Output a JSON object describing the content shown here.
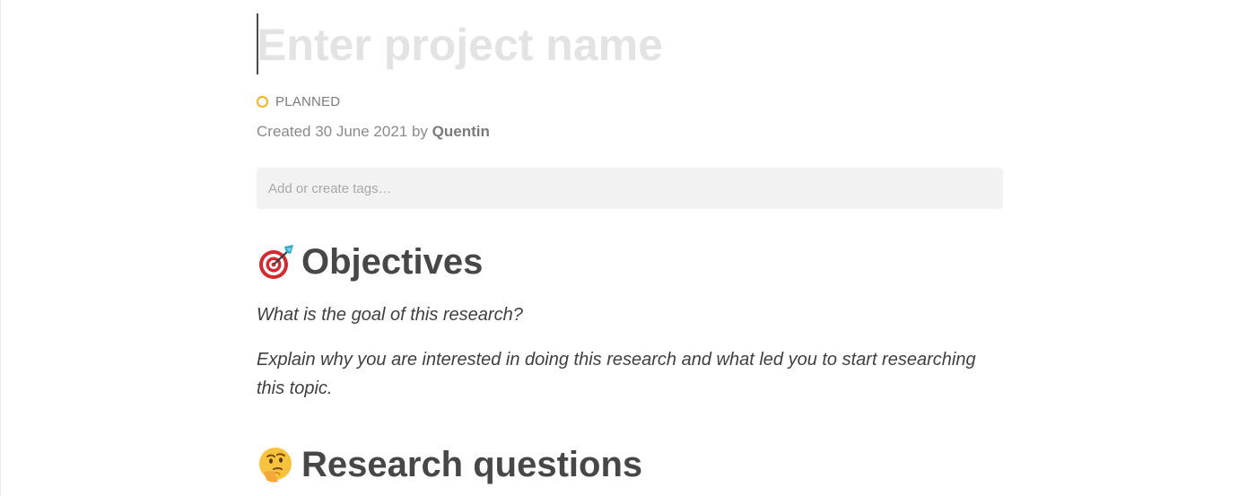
{
  "project": {
    "title_placeholder": "Enter project name",
    "status": {
      "label": "PLANNED",
      "color": "#f0b429",
      "icon": "circle-outline-icon"
    },
    "created": {
      "prefix": "Created 30 June 2021 by",
      "author": "Quentin"
    },
    "tags": {
      "placeholder": "Add or create tags…"
    }
  },
  "sections": [
    {
      "icon": "target-dart-icon",
      "heading": "Objectives",
      "prompts": [
        "What is the goal of this research?",
        "Explain why you are interested in doing this research and what led you to start researching this topic."
      ]
    },
    {
      "icon": "thinking-face-icon",
      "heading": "Research questions"
    }
  ]
}
